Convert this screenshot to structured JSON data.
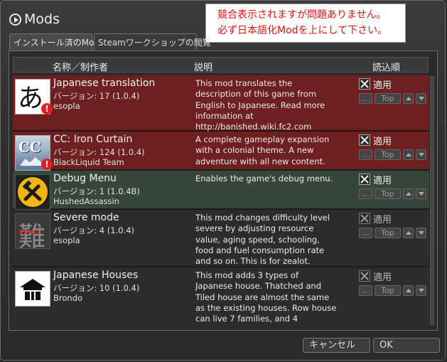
{
  "window": {
    "title": "Mods"
  },
  "notice": {
    "line1": "競合表示されますが問題ありません。",
    "line2": "必ず日本語化Modを上にして下さい。"
  },
  "tabs": [
    {
      "label": "インストール済のMods",
      "active": true
    },
    {
      "label": "Steamワークショップの閲覧",
      "active": false
    }
  ],
  "columns": {
    "name": "名称／制作者",
    "description": "説明",
    "load_order": "読込順"
  },
  "mods": [
    {
      "name": "Japanese translation",
      "version": "バージョン: 17 (1.0.4)",
      "author": "esopla",
      "description": "This mod translates the description of this game from English to Japanese. Read more information at http://banished.wiki.fc2.com",
      "apply_label": "適用",
      "checked": true,
      "warning": "!",
      "icon_glyph": "あ",
      "dots": "...",
      "top": "Top"
    },
    {
      "name": "CC: Iron Curtain",
      "version": "バージョン: 124 (1.0.4)",
      "author": "BlackLiquid Team",
      "description": "A complete gameplay expansion with a colonial theme. A new adventure with all new content.",
      "apply_label": "適用",
      "checked": true,
      "warning": "!",
      "icon_glyph": "CC",
      "dots": "...",
      "top": "Top"
    },
    {
      "name": "Debug Menu",
      "version": "バージョン: 1 (1.0.4B)",
      "author": "HushedAssassin",
      "description": "Enables the game's debug menu.",
      "apply_label": "適用",
      "checked": true,
      "icon_glyph": "",
      "dots": "...",
      "top": "Top"
    },
    {
      "name": "Severe mode",
      "version": "バージョン: 4 (1.0.4)",
      "author": "esopla",
      "description": "This mod changes difficulty level severe by adjusting resource value, aging speed, schooling, food and fuel consumption rate and so on. This is for zealot.",
      "apply_label": "適用",
      "checked": true,
      "icon_glyph": "難",
      "icon_label": "Severe",
      "dots": "...",
      "top": "Top"
    },
    {
      "name": "Japanese Houses",
      "version": "バージョン: 10 (1.0.4)",
      "author": "Brondo",
      "description": "This mod adds 3 types of Japanese house. Thatched and Tiled house are almost the same as the existing houses. Row house can live 7 families, and 4",
      "apply_label": "適用",
      "checked": true,
      "icon_glyph": "",
      "dots": "...",
      "top": "Top"
    }
  ],
  "footer": {
    "cancel": "キャンセル",
    "ok": "OK"
  },
  "colors": {
    "row_error": "#6e1f1f",
    "row_ok": "#37463a",
    "notice_text": "#e01010"
  }
}
